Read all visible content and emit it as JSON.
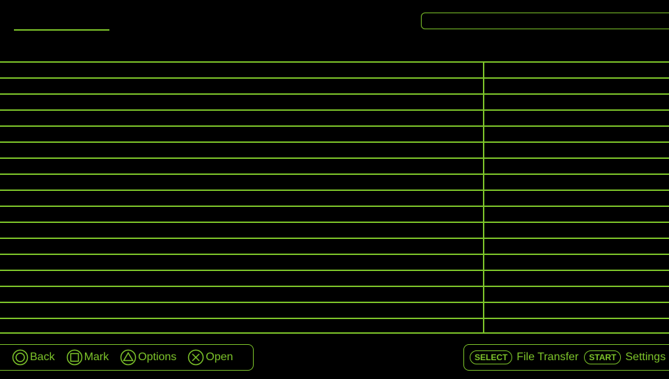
{
  "header": {
    "title": "",
    "path": ""
  },
  "file_list": {
    "row_count": 17,
    "rows": []
  },
  "footer": {
    "left_hints": [
      {
        "icon": "circle-button-icon",
        "label": "Back"
      },
      {
        "icon": "square-button-icon",
        "label": "Mark"
      },
      {
        "icon": "triangle-button-icon",
        "label": "Options"
      },
      {
        "icon": "cross-button-icon",
        "label": "Open"
      }
    ],
    "right_hints": [
      {
        "button": "SELECT",
        "label": "File Transfer"
      },
      {
        "button": "START",
        "label": "Settings"
      }
    ]
  },
  "colors": {
    "accent": "#7dc42a",
    "background": "#000000"
  }
}
